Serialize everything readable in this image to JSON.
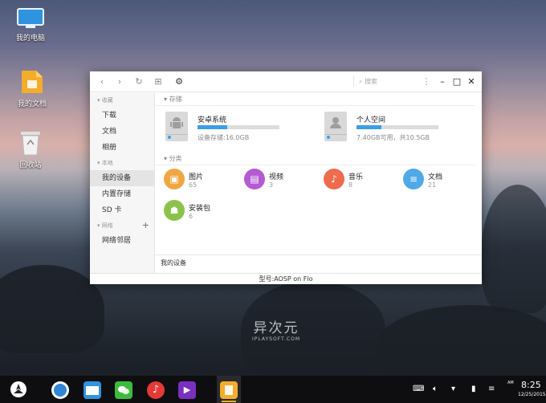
{
  "desktop": {
    "icons": [
      {
        "label": "我的电脑",
        "icon": "monitor-icon"
      },
      {
        "label": "我的文档",
        "icon": "folder-icon"
      },
      {
        "label": "回收站",
        "icon": "recycle-bin-icon"
      }
    ]
  },
  "window": {
    "toolbar": {
      "search_placeholder": "搜索"
    },
    "sidebar": {
      "groups": [
        {
          "title": "收藏",
          "items": [
            "下载",
            "文档",
            "相册"
          ]
        },
        {
          "title": "本地",
          "items": [
            "我的设备",
            "内置存储",
            "SD 卡"
          ]
        },
        {
          "title": "网络",
          "items": [
            "网络邻居"
          ]
        }
      ],
      "active": "我的设备"
    },
    "storage_section": "存储",
    "storage": [
      {
        "name": "安卓系统",
        "info": "设备存储:16.0GB",
        "fill": 0.36,
        "icon": "android-drive-icon"
      },
      {
        "name": "个人空间",
        "info": "7.40GB可用，共10.5GB",
        "fill": 0.3,
        "icon": "user-drive-icon"
      }
    ],
    "category_section": "分类",
    "categories": [
      {
        "name": "图片",
        "count": "65",
        "color": "#f0a742",
        "icon": "image-icon"
      },
      {
        "name": "视频",
        "count": "3",
        "color": "#b45ad3",
        "icon": "video-icon"
      },
      {
        "name": "音乐",
        "count": "8",
        "color": "#f06a4e",
        "icon": "music-icon"
      },
      {
        "name": "文档",
        "count": "21",
        "color": "#4fa8e8",
        "icon": "document-icon"
      },
      {
        "name": "安装包",
        "count": "6",
        "color": "#8bc34a",
        "icon": "apk-icon"
      }
    ],
    "path": "我的设备",
    "status": "型号:AOSP on Flo"
  },
  "watermark": {
    "title": "异次元",
    "sub": "IPLAYSOFT.COM"
  },
  "taskbar": {
    "time": "8:25",
    "ampm": "AM",
    "date": "12/25/2015"
  }
}
